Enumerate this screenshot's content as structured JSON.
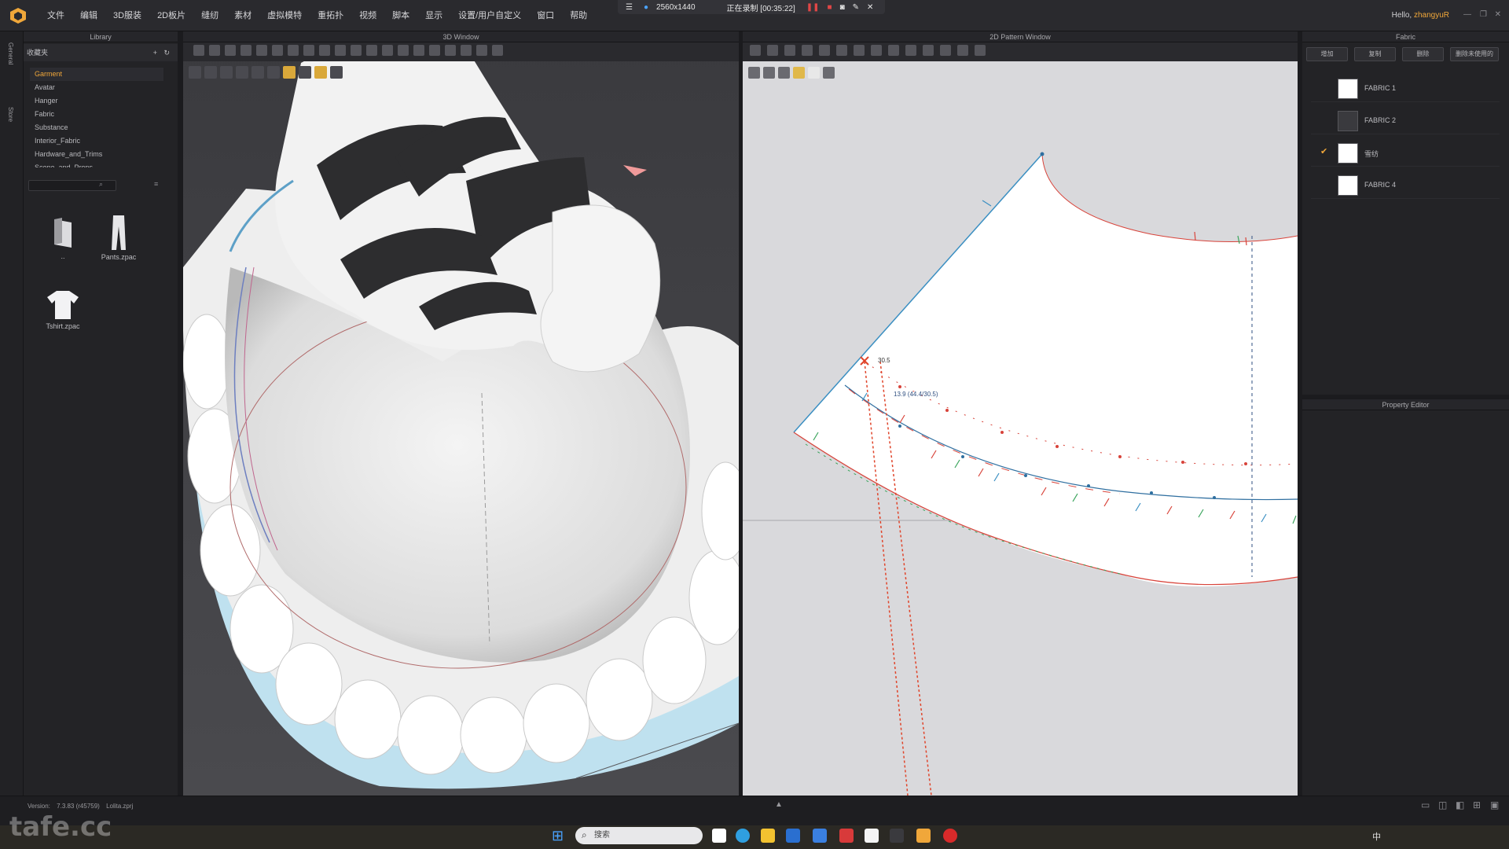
{
  "menubar": {
    "items": [
      "文件",
      "编辑",
      "3D服装",
      "2D板片",
      "缝纫",
      "素材",
      "虚拟模特",
      "重拓扑",
      "视频",
      "脚本",
      "显示",
      "设置/用户自定义",
      "窗口",
      "帮助"
    ],
    "recording": {
      "resolution": "2560x1440",
      "status": "正在录制 [00:35:22]"
    },
    "greeting": "Hello,",
    "username": "zhangyuR"
  },
  "left_strip": {
    "tabs": [
      "General",
      "Store"
    ]
  },
  "library": {
    "title": "Library",
    "favorites_label": "收藏夹",
    "tree": [
      {
        "label": "Garment",
        "active": true
      },
      {
        "label": "Avatar",
        "active": false
      },
      {
        "label": "Hanger",
        "active": false
      },
      {
        "label": "Fabric",
        "active": false
      },
      {
        "label": "Substance",
        "active": false
      },
      {
        "label": "Interior_Fabric",
        "active": false
      },
      {
        "label": "Hardware_and_Trims",
        "active": false
      },
      {
        "label": "Scene_and_Props",
        "active": false
      }
    ],
    "items": [
      {
        "label": "..",
        "icon": "folder-up-icon"
      },
      {
        "label": "Pants.zpac",
        "icon": "pants-icon"
      },
      {
        "label": "Tshirt.zpac",
        "icon": "tshirt-icon"
      }
    ]
  },
  "view3d": {
    "title": "3D Window"
  },
  "view2d": {
    "title": "2D Pattern Window",
    "measure_point": "30.5",
    "measure_label": "13.9 (44.4/30.5)"
  },
  "fabric": {
    "title": "Fabric",
    "buttons": [
      "增加",
      "复制",
      "删除",
      "删除未使用的"
    ],
    "list": [
      {
        "name": "FABRIC 1",
        "color": "#ffffff",
        "checked": false
      },
      {
        "name": "FABRIC 2",
        "color": "#3a3a3e",
        "checked": false
      },
      {
        "name": "雪纺",
        "color": "#ffffff",
        "checked": true
      },
      {
        "name": "FABRIC 4",
        "color": "#ffffff",
        "checked": false
      }
    ]
  },
  "property_editor": {
    "title": "Property Editor"
  },
  "status": {
    "version_label": "Version:",
    "version": "7.3.83 (r45759)",
    "file": "Lolita.zprj"
  },
  "taskbar": {
    "search_placeholder": "搜索",
    "ime": "中"
  },
  "watermark": "tafe.cc",
  "colors": {
    "accent": "#f0a73a",
    "panel": "#232326",
    "pattern_bg": "#d9d9dc",
    "seam_red": "#d8433a",
    "seam_blue": "#2f8fc0"
  }
}
